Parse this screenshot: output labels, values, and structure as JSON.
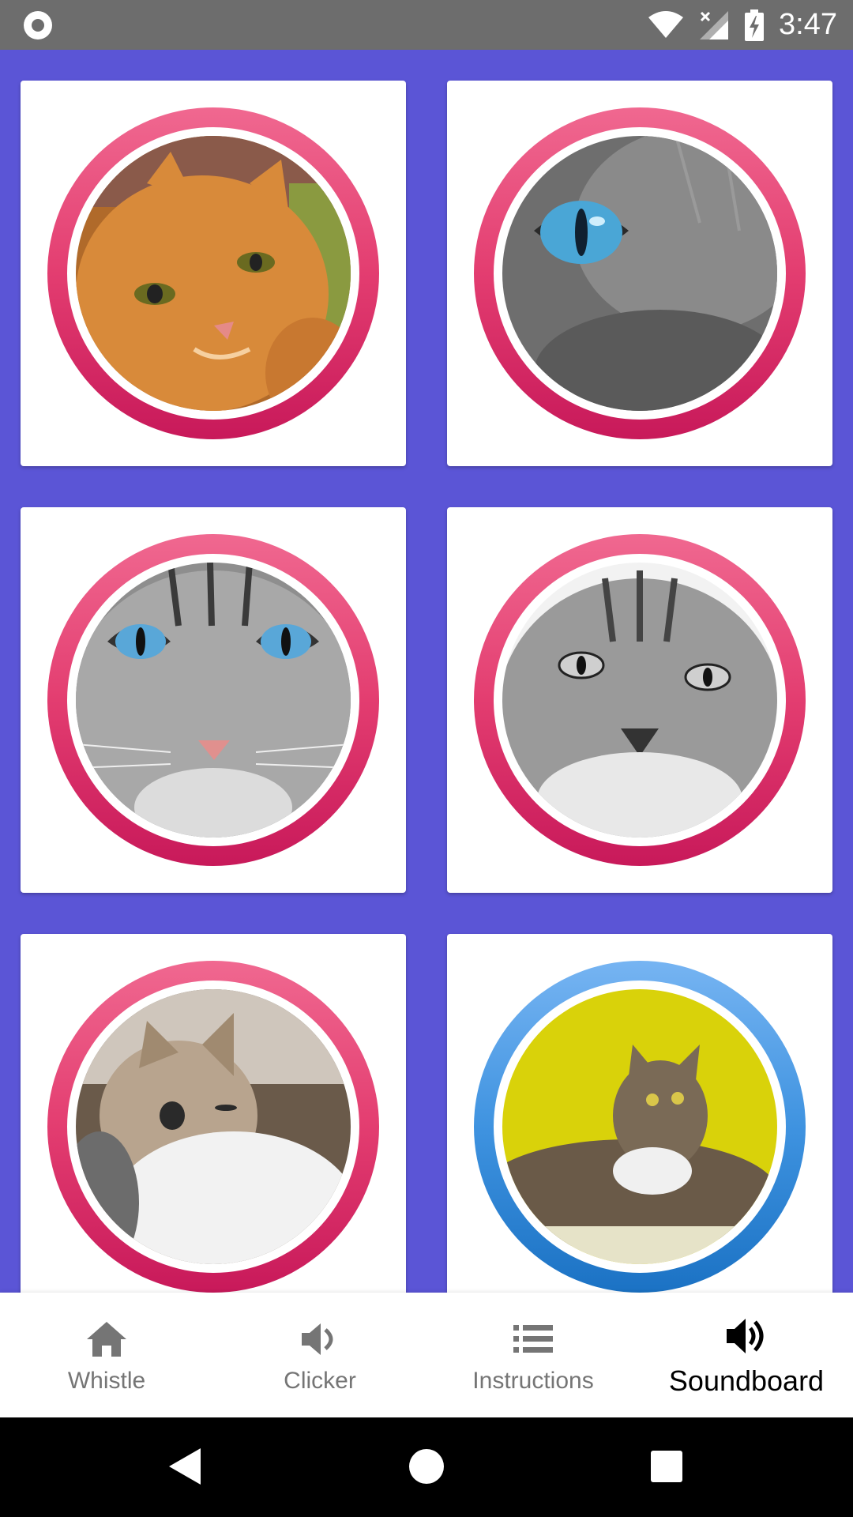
{
  "status_bar": {
    "time": "3:47",
    "icons": [
      "notification-ring-icon",
      "wifi-icon",
      "signal-icon",
      "battery-charging-icon"
    ]
  },
  "soundboard": {
    "cards": [
      {
        "name": "orange-tabby-cat",
        "ring_color": "#e33d70"
      },
      {
        "name": "blue-eye-gray-cat",
        "ring_color": "#e33d70"
      },
      {
        "name": "blue-eyed-tabby-cat",
        "ring_color": "#e33d70"
      },
      {
        "name": "bw-tabby-cat",
        "ring_color": "#e33d70"
      },
      {
        "name": "kitten",
        "ring_color": "#e33d70"
      },
      {
        "name": "yellow-bg-tabby-cat",
        "ring_color": "#3f93e0"
      }
    ]
  },
  "bottom_nav": {
    "items": [
      {
        "label": "Whistle",
        "icon": "home-icon",
        "active": false
      },
      {
        "label": "Clicker",
        "icon": "volume-icon",
        "active": false
      },
      {
        "label": "Instructions",
        "icon": "list-icon",
        "active": false
      },
      {
        "label": "Soundboard",
        "icon": "volume-loud-icon",
        "active": true
      }
    ]
  },
  "colors": {
    "background": "#5b55d6",
    "status_bar": "#6d6d6d",
    "ring_pink": "#e33d70",
    "ring_blue": "#3f93e0"
  }
}
